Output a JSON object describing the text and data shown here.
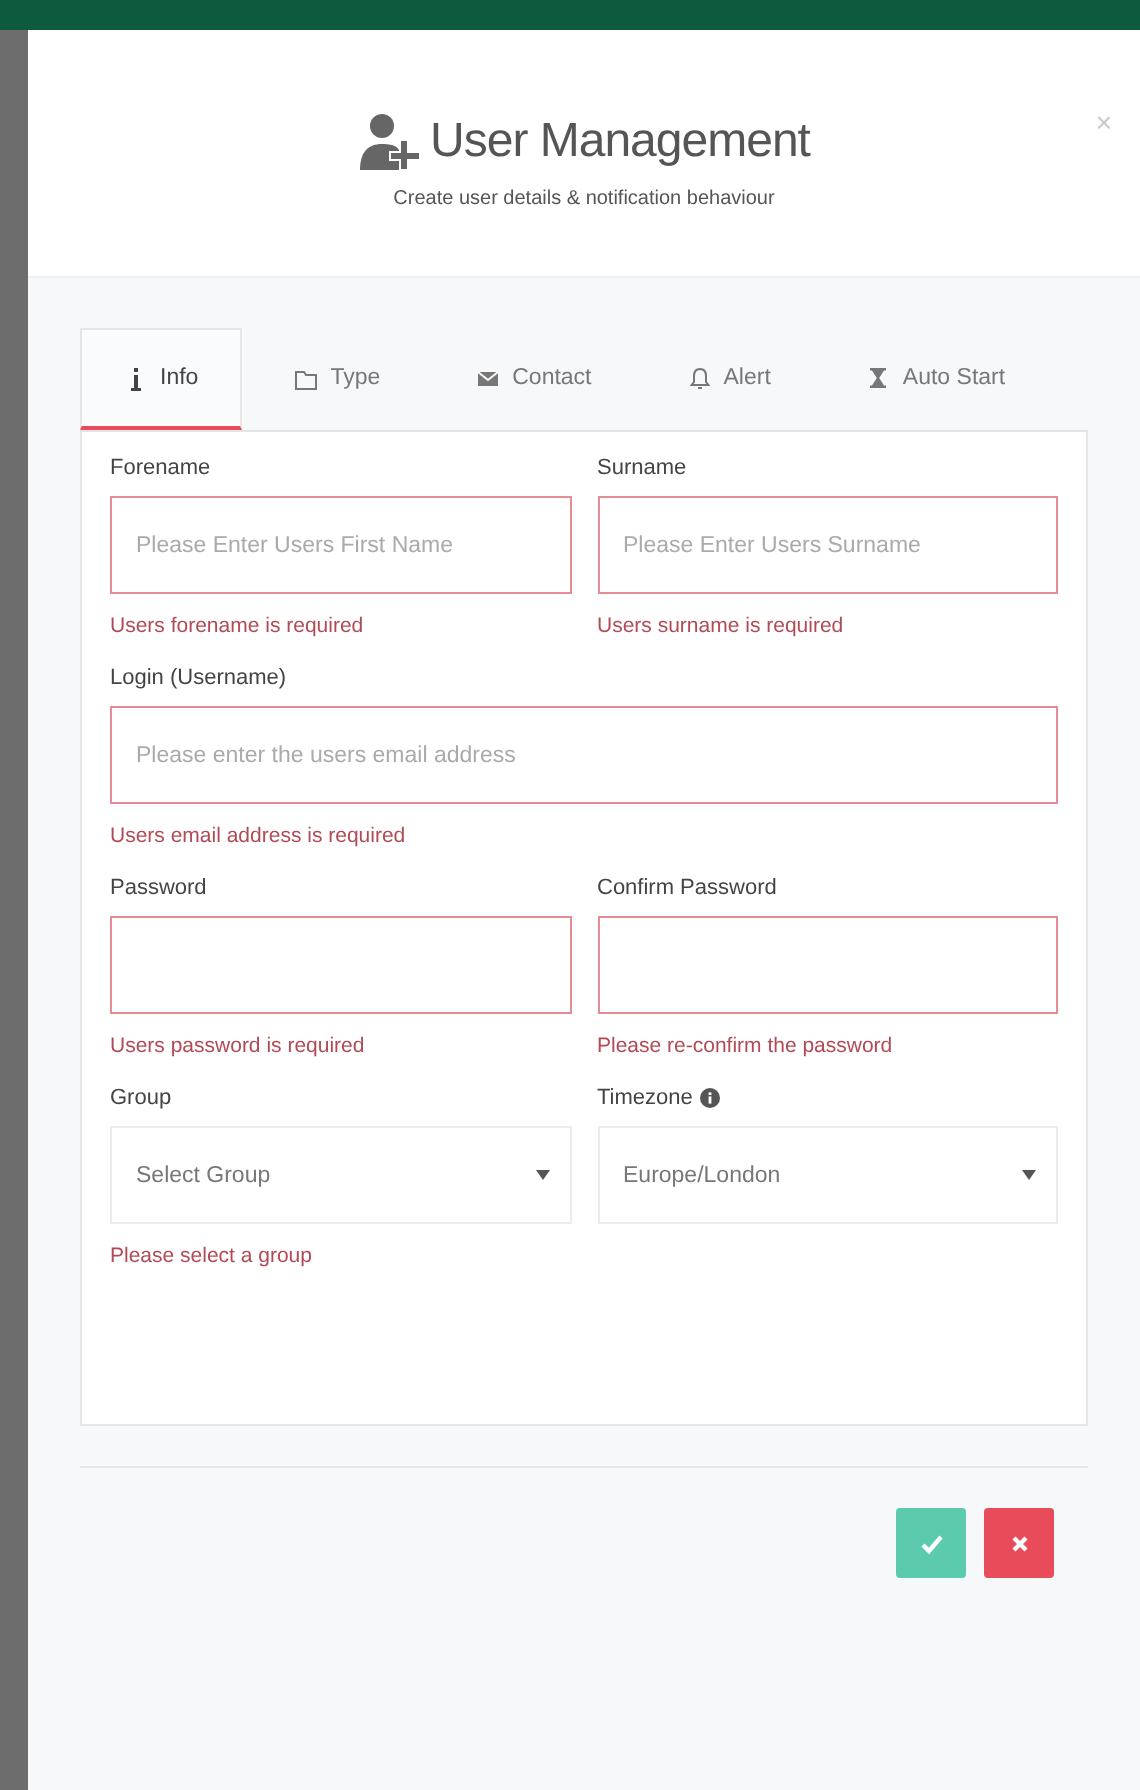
{
  "dialog": {
    "title": "User Management",
    "subtitle": "Create user details & notification behaviour",
    "close": "×"
  },
  "tabs": [
    {
      "label": "Info",
      "selected": true
    },
    {
      "label": "Type",
      "selected": false
    },
    {
      "label": "Contact",
      "selected": false
    },
    {
      "label": "Alert",
      "selected": false
    },
    {
      "label": "Auto Start",
      "selected": false
    }
  ],
  "rows": [
    {
      "fields": [
        {
          "kind": "text",
          "label": "Forename",
          "placeholder": "Please Enter Users First Name",
          "invalid": true,
          "error": "Users forename is required"
        },
        {
          "kind": "text",
          "label": "Surname",
          "placeholder": "Please Enter Users Surname",
          "invalid": true,
          "error": "Users surname is required"
        }
      ]
    },
    {
      "fields": [
        {
          "kind": "text",
          "label": "Login (Username)",
          "placeholder": "Please enter the users email address",
          "invalid": true,
          "error": "Users email address is required"
        }
      ]
    },
    {
      "fields": [
        {
          "kind": "password",
          "label": "Password",
          "invalid": true,
          "error": "Users password is required"
        },
        {
          "kind": "password",
          "label": "Confirm Password",
          "invalid": true,
          "error": "Please re-confirm the password"
        }
      ]
    },
    {
      "fields": [
        {
          "kind": "select",
          "label": "Group",
          "value": "Select Group",
          "invalid": false,
          "error": "Please select a group"
        },
        {
          "kind": "select",
          "label": "Timezone",
          "info": true,
          "value": "Europe/London",
          "invalid": false
        }
      ]
    }
  ],
  "buttons": [
    {
      "kind": "confirm"
    },
    {
      "kind": "cancel"
    }
  ]
}
